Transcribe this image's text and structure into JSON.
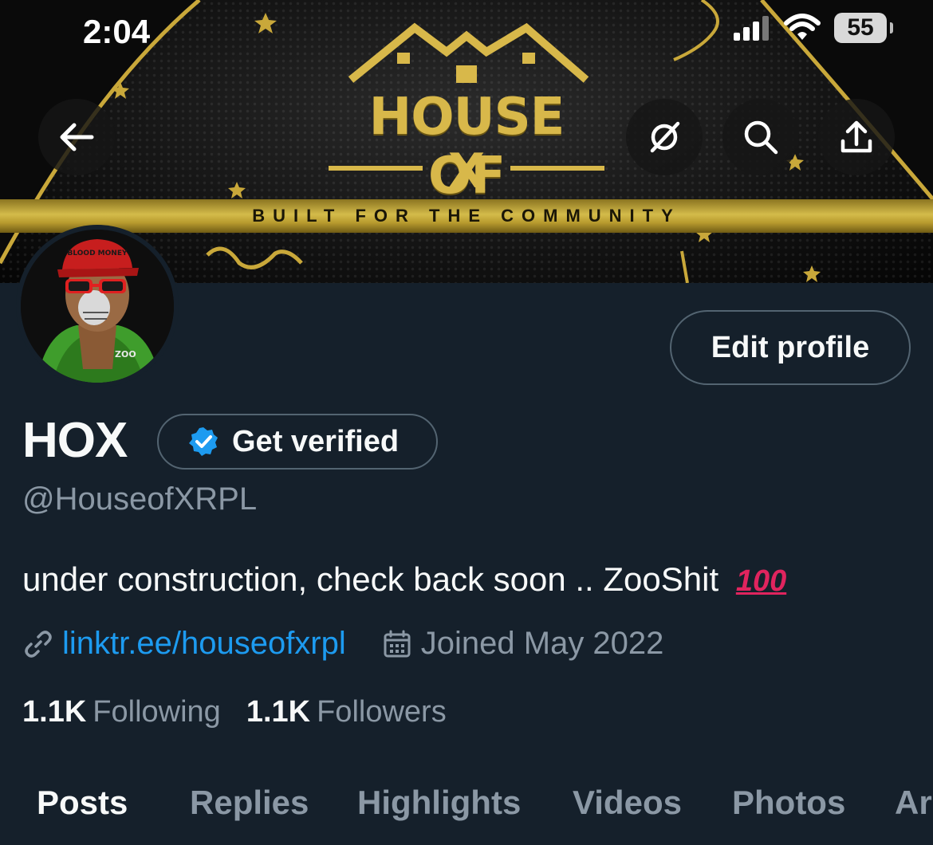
{
  "status_bar": {
    "time": "2:04",
    "battery": "55"
  },
  "banner": {
    "logo_line1": "HOUSE OF",
    "logo_line2": "X",
    "tagline": "BUILT FOR THE COMMUNITY"
  },
  "header_icons": [
    "back-arrow-icon",
    "grok-icon",
    "search-icon",
    "share-icon"
  ],
  "avatar": {
    "cap_text": "BLOOD MONEY",
    "tag_text": "ZOO"
  },
  "profile": {
    "edit_label": "Edit profile",
    "name": "HOX",
    "verify_label": "Get verified",
    "handle": "@HouseofXRPL",
    "bio": "under construction, check back soon .. ZooShit",
    "bio_emoji": "100",
    "link": "linktr.ee/houseofxrpl",
    "joined": "Joined May 2022",
    "following_count": "1.1K",
    "following_label": "Following",
    "followers_count": "1.1K",
    "followers_label": "Followers"
  },
  "tabs": [
    {
      "label": "Posts"
    },
    {
      "label": "Replies"
    },
    {
      "label": "Highlights"
    },
    {
      "label": "Videos"
    },
    {
      "label": "Photos"
    },
    {
      "label": "Ar"
    }
  ],
  "colors": {
    "background": "#15202b",
    "link": "#1d9bf0",
    "muted": "#8b98a5",
    "border": "#536471",
    "gold": "#d8b84a",
    "verified": "#1d9bf0"
  }
}
